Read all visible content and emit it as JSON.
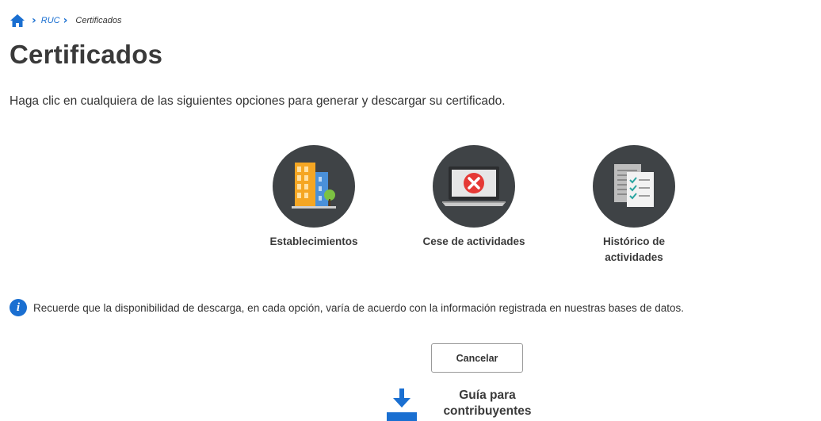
{
  "breadcrumb": {
    "home_icon": "home-icon",
    "items": [
      {
        "label": "RUC"
      },
      {
        "label": "Certificados"
      }
    ]
  },
  "page_title": "Certificados",
  "instruction": "Haga clic en cualquiera de las siguientes opciones para generar y descargar su certificado.",
  "options": [
    {
      "icon": "buildings-icon",
      "label": "Establecimientos"
    },
    {
      "icon": "laptop-cancel-icon",
      "label": "Cese de actividades"
    },
    {
      "icon": "document-checklist-icon",
      "label_line1": "Histórico de",
      "label_line2": "actividades"
    }
  ],
  "notice": {
    "icon": "info-icon",
    "icon_glyph": "i",
    "text": "Recuerde que la disponibilidad de descarga, en cada opción, varía de acuerdo con la información registrada en nuestras bases de datos."
  },
  "cancel_label": "Cancelar",
  "guide": {
    "icon": "download-icon",
    "label_line1": "Guía para",
    "label_line2": "contribuyentes"
  },
  "colors": {
    "accent": "#1a6fd1",
    "circle_bg": "#3f4346",
    "building_orange": "#f5a623",
    "building_blue": "#4a90d9",
    "cancel_red": "#e53935"
  }
}
